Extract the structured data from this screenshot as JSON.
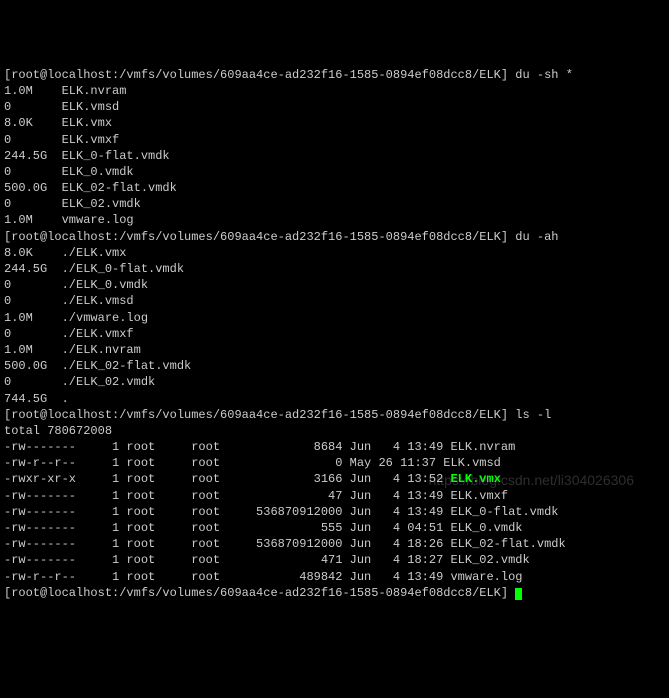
{
  "prompt1": "[root@localhost:/vmfs/volumes/609aa4ce-ad232f16-1585-0894ef08dcc8/ELK] du -sh *",
  "du_sh": [
    {
      "size": "1.0M",
      "name": "ELK.nvram"
    },
    {
      "size": "0",
      "name": "ELK.vmsd"
    },
    {
      "size": "8.0K",
      "name": "ELK.vmx"
    },
    {
      "size": "0",
      "name": "ELK.vmxf"
    },
    {
      "size": "244.5G",
      "name": "ELK_0-flat.vmdk"
    },
    {
      "size": "0",
      "name": "ELK_0.vmdk"
    },
    {
      "size": "500.0G",
      "name": "ELK_02-flat.vmdk"
    },
    {
      "size": "0",
      "name": "ELK_02.vmdk"
    },
    {
      "size": "1.0M",
      "name": "vmware.log"
    }
  ],
  "prompt2": "[root@localhost:/vmfs/volumes/609aa4ce-ad232f16-1585-0894ef08dcc8/ELK] du -ah",
  "du_ah": [
    {
      "size": "8.0K",
      "name": "./ELK.vmx"
    },
    {
      "size": "244.5G",
      "name": "./ELK_0-flat.vmdk"
    },
    {
      "size": "0",
      "name": "./ELK_0.vmdk"
    },
    {
      "size": "0",
      "name": "./ELK.vmsd"
    },
    {
      "size": "1.0M",
      "name": "./vmware.log"
    },
    {
      "size": "0",
      "name": "./ELK.vmxf"
    },
    {
      "size": "1.0M",
      "name": "./ELK.nvram"
    },
    {
      "size": "500.0G",
      "name": "./ELK_02-flat.vmdk"
    },
    {
      "size": "0",
      "name": "./ELK_02.vmdk"
    },
    {
      "size": "744.5G",
      "name": "."
    }
  ],
  "prompt3": "[root@localhost:/vmfs/volumes/609aa4ce-ad232f16-1585-0894ef08dcc8/ELK] ls -l",
  "total": "total 780672008",
  "ls": [
    {
      "perm": "-rw-------",
      "links": "1",
      "owner": "root",
      "group": "root",
      "size": "8684",
      "date": "Jun   4 13:49",
      "name": "ELK.nvram",
      "hl": false
    },
    {
      "perm": "-rw-r--r--",
      "links": "1",
      "owner": "root",
      "group": "root",
      "size": "0",
      "date": "May 26 11:37",
      "name": "ELK.vmsd",
      "hl": false
    },
    {
      "perm": "-rwxr-xr-x",
      "links": "1",
      "owner": "root",
      "group": "root",
      "size": "3166",
      "date": "Jun   4 13:52",
      "name": "ELK.vmx",
      "hl": true
    },
    {
      "perm": "-rw-------",
      "links": "1",
      "owner": "root",
      "group": "root",
      "size": "47",
      "date": "Jun   4 13:49",
      "name": "ELK.vmxf",
      "hl": false
    },
    {
      "perm": "-rw-------",
      "links": "1",
      "owner": "root",
      "group": "root",
      "size": "536870912000",
      "date": "Jun   4 13:49",
      "name": "ELK_0-flat.vmdk",
      "hl": false
    },
    {
      "perm": "-rw-------",
      "links": "1",
      "owner": "root",
      "group": "root",
      "size": "555",
      "date": "Jun   4 04:51",
      "name": "ELK_0.vmdk",
      "hl": false
    },
    {
      "perm": "-rw-------",
      "links": "1",
      "owner": "root",
      "group": "root",
      "size": "536870912000",
      "date": "Jun   4 18:26",
      "name": "ELK_02-flat.vmdk",
      "hl": false
    },
    {
      "perm": "-rw-------",
      "links": "1",
      "owner": "root",
      "group": "root",
      "size": "471",
      "date": "Jun   4 18:27",
      "name": "ELK_02.vmdk",
      "hl": false
    },
    {
      "perm": "-rw-r--r--",
      "links": "1",
      "owner": "root",
      "group": "root",
      "size": "489842",
      "date": "Jun   4 13:49",
      "name": "vmware.log",
      "hl": false
    }
  ],
  "prompt4": "[root@localhost:/vmfs/volumes/609aa4ce-ad232f16-1585-0894ef08dcc8/ELK] ",
  "watermark": "https://blog.csdn.net/li304026306"
}
